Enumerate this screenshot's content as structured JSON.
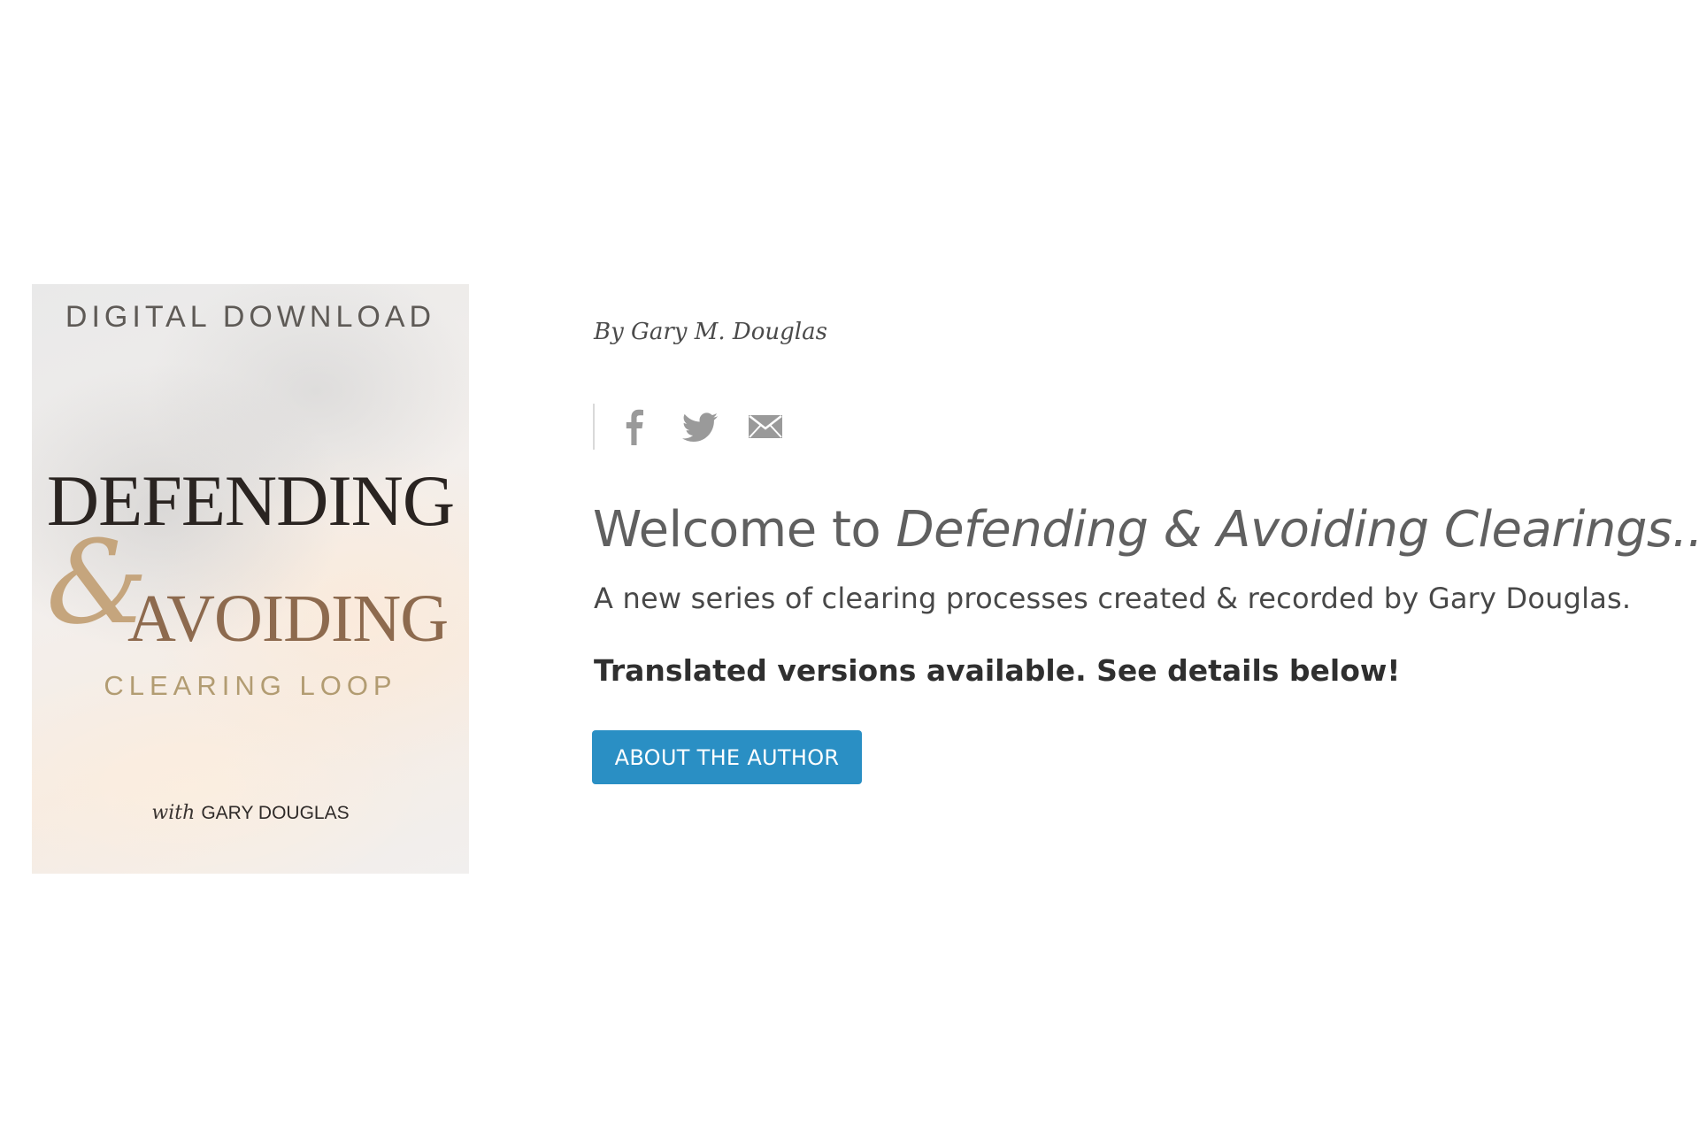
{
  "cover": {
    "top_text": "DIGITAL DOWNLOAD",
    "title_line1": "DEFENDING",
    "ampersand": "&",
    "title_line2": "AVOIDING",
    "subtitle": "CLEARING LOOP",
    "with_text": "with",
    "author_text": "GARY DOUGLAS"
  },
  "byline": "By Gary M. Douglas",
  "share": {
    "icons": [
      "facebook-icon",
      "twitter-icon",
      "email-icon"
    ],
    "color": "#9a9a9a"
  },
  "headline": {
    "prefix": "Welcome to ",
    "italic": "Defending & Avoiding Clearings..."
  },
  "subhead": "A new series of clearing processes created & recorded by Gary Douglas.",
  "translated_notice": "Translated versions available. See details below!",
  "about_button": {
    "label": "ABOUT THE AUTHOR",
    "color": "#2a8fc4"
  }
}
